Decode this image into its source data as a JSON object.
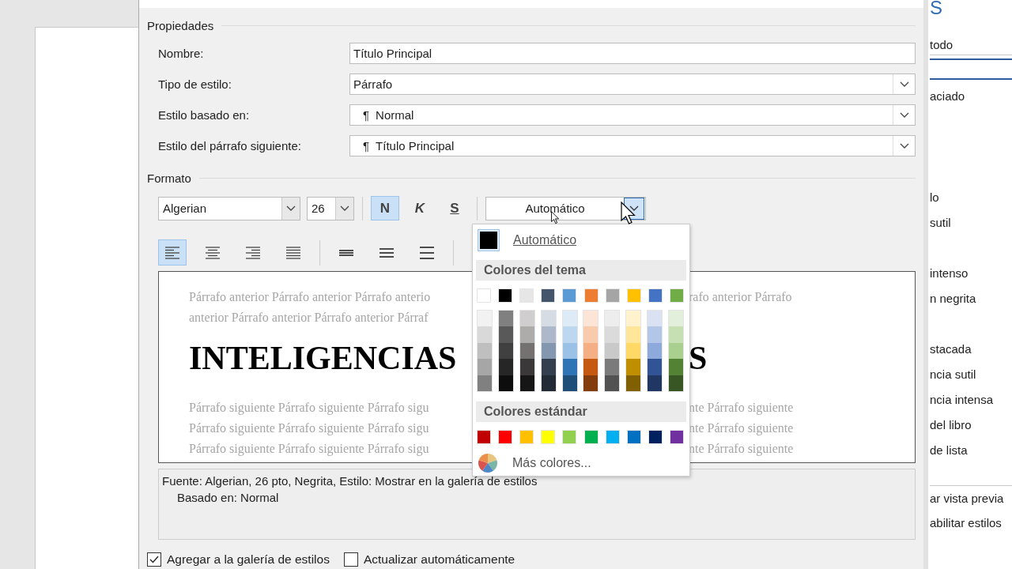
{
  "properties": {
    "title": "Propiedades",
    "fields": [
      {
        "label": "Nombre:",
        "kind": "text",
        "value": "Título Principal"
      },
      {
        "label": "Tipo de estilo:",
        "kind": "dropdown",
        "value": "Párrafo"
      },
      {
        "label": "Estilo basado en:",
        "kind": "dropdown",
        "marker": "¶",
        "value": "Normal"
      },
      {
        "label": "Estilo del párrafo siguiente:",
        "kind": "dropdown",
        "marker": "¶",
        "value": "Título Principal"
      }
    ]
  },
  "format": {
    "title": "Formato",
    "font": "Algerian",
    "size": "26",
    "styles": [
      {
        "label": "N",
        "kind": "bold",
        "selected": true
      },
      {
        "label": "K",
        "kind": "italic",
        "selected": false
      },
      {
        "label": "S",
        "kind": "underline",
        "selected": false
      }
    ],
    "color_label": "Automático",
    "alignments": [
      {
        "kind": "left",
        "selected": true
      },
      {
        "kind": "center",
        "selected": false
      },
      {
        "kind": "right",
        "selected": false
      },
      {
        "kind": "justify",
        "selected": false
      }
    ],
    "spacing": [
      {
        "kind": "single"
      },
      {
        "kind": "one-half"
      },
      {
        "kind": "double"
      }
    ]
  },
  "color_picker": {
    "automatic": {
      "label": "Automático",
      "color": "#000000"
    },
    "theme_title": "Colores del tema",
    "theme_colors": [
      {
        "color": "#ffffff",
        "shades": [
          {
            "color": "#f2f2f2"
          },
          {
            "color": "#d9d9d9"
          },
          {
            "color": "#bfbfbf"
          },
          {
            "color": "#a6a6a6"
          },
          {
            "color": "#808080"
          }
        ]
      },
      {
        "color": "#000000",
        "shades": [
          {
            "color": "#808080"
          },
          {
            "color": "#595959"
          },
          {
            "color": "#404040"
          },
          {
            "color": "#262626"
          },
          {
            "color": "#0d0d0d"
          }
        ]
      },
      {
        "color": "#e7e6e6",
        "shades": [
          {
            "color": "#d0cece"
          },
          {
            "color": "#aeabab"
          },
          {
            "color": "#757171"
          },
          {
            "color": "#3a3838"
          },
          {
            "color": "#171616"
          }
        ]
      },
      {
        "color": "#44546a",
        "shades": [
          {
            "color": "#d6dce4"
          },
          {
            "color": "#adb9ca"
          },
          {
            "color": "#8497b0"
          },
          {
            "color": "#333f4f"
          },
          {
            "color": "#222a35"
          }
        ]
      },
      {
        "color": "#5b9bd5",
        "shades": [
          {
            "color": "#ddebf7"
          },
          {
            "color": "#bdd7ee"
          },
          {
            "color": "#9bc2e6"
          },
          {
            "color": "#2f75b5"
          },
          {
            "color": "#1f4e78"
          }
        ]
      },
      {
        "color": "#ed7d31",
        "shades": [
          {
            "color": "#fce4d6"
          },
          {
            "color": "#f8cbad"
          },
          {
            "color": "#f4b084"
          },
          {
            "color": "#c65911"
          },
          {
            "color": "#833c0c"
          }
        ]
      },
      {
        "color": "#a5a5a5",
        "shades": [
          {
            "color": "#ededed"
          },
          {
            "color": "#dbdbdb"
          },
          {
            "color": "#c9c9c9"
          },
          {
            "color": "#7b7b7b"
          },
          {
            "color": "#525252"
          }
        ]
      },
      {
        "color": "#ffc000",
        "shades": [
          {
            "color": "#fff2cc"
          },
          {
            "color": "#ffe699"
          },
          {
            "color": "#ffd966"
          },
          {
            "color": "#bf8f00"
          },
          {
            "color": "#806000"
          }
        ]
      },
      {
        "color": "#4472c4",
        "shades": [
          {
            "color": "#d9e1f2"
          },
          {
            "color": "#b4c6e7"
          },
          {
            "color": "#8ea9db"
          },
          {
            "color": "#305496"
          },
          {
            "color": "#203764"
          }
        ]
      },
      {
        "color": "#70ad47",
        "shades": [
          {
            "color": "#e2efda"
          },
          {
            "color": "#c6e0b4"
          },
          {
            "color": "#a9d08e"
          },
          {
            "color": "#548235"
          },
          {
            "color": "#375623"
          }
        ]
      }
    ],
    "standard_title": "Colores estándar",
    "standard_colors": [
      {
        "color": "#c00000"
      },
      {
        "color": "#ff0000"
      },
      {
        "color": "#ffc000"
      },
      {
        "color": "#ffff00"
      },
      {
        "color": "#92d050"
      },
      {
        "color": "#00b050"
      },
      {
        "color": "#00b0f0"
      },
      {
        "color": "#0070c0"
      },
      {
        "color": "#002060"
      },
      {
        "color": "#7030a0"
      }
    ],
    "more": "Más colores..."
  },
  "preview": {
    "before": [
      {
        "left": "Párrafo anterior Párrafo anterior Párrafo anterio",
        "right": "rafo anterior Párrafo"
      },
      {
        "left": "anterior Párrafo anterior Párrafo anterior Párraf"
      }
    ],
    "heading": {
      "left": "INTELIGENCIAS",
      "right": "S"
    },
    "after": [
      {
        "left": "Párrafo siguiente Párrafo siguiente Párrafo sigu",
        "right": "nte Párrafo siguiente"
      },
      {
        "left": "Párrafo siguiente Párrafo siguiente Párrafo sigu",
        "right": "nte Párrafo siguiente"
      },
      {
        "left": "Párrafo siguiente Párrafo siguiente Párrafo sigu",
        "right": "nte Párrafo siguiente"
      }
    ]
  },
  "description": [
    "Fuente: Algerian, 26 pto, Negrita, Estilo: Mostrar en la galería de estilos",
    "Basado en: Normal"
  ],
  "options": [
    {
      "label": "Agregar a la galería de estilos",
      "checked": true
    },
    {
      "label": "Actualizar automáticamente",
      "checked": false
    }
  ],
  "styles_pane": {
    "title": "S",
    "clear": "todo",
    "items": [
      {
        "selected": true
      },
      {
        "label": "aciado",
        "selected": false
      },
      {
        "selected": false
      },
      {
        "selected": false
      },
      {
        "selected": false
      },
      {
        "label": "lo",
        "selected": false
      },
      {
        "label": "sutil",
        "selected": false
      },
      {
        "selected": false
      },
      {
        "label": "intenso",
        "selected": false
      },
      {
        "label": "n negrita",
        "selected": false
      },
      {
        "selected": false
      },
      {
        "label": "stacada",
        "selected": false
      },
      {
        "label": "ncia sutil",
        "selected": false
      },
      {
        "label": "ncia intensa",
        "selected": false
      },
      {
        "label": "del libro",
        "selected": false
      },
      {
        "label": "de lista",
        "selected": false
      }
    ],
    "options": [
      "ar vista previa",
      "abilitar estilos"
    ]
  }
}
